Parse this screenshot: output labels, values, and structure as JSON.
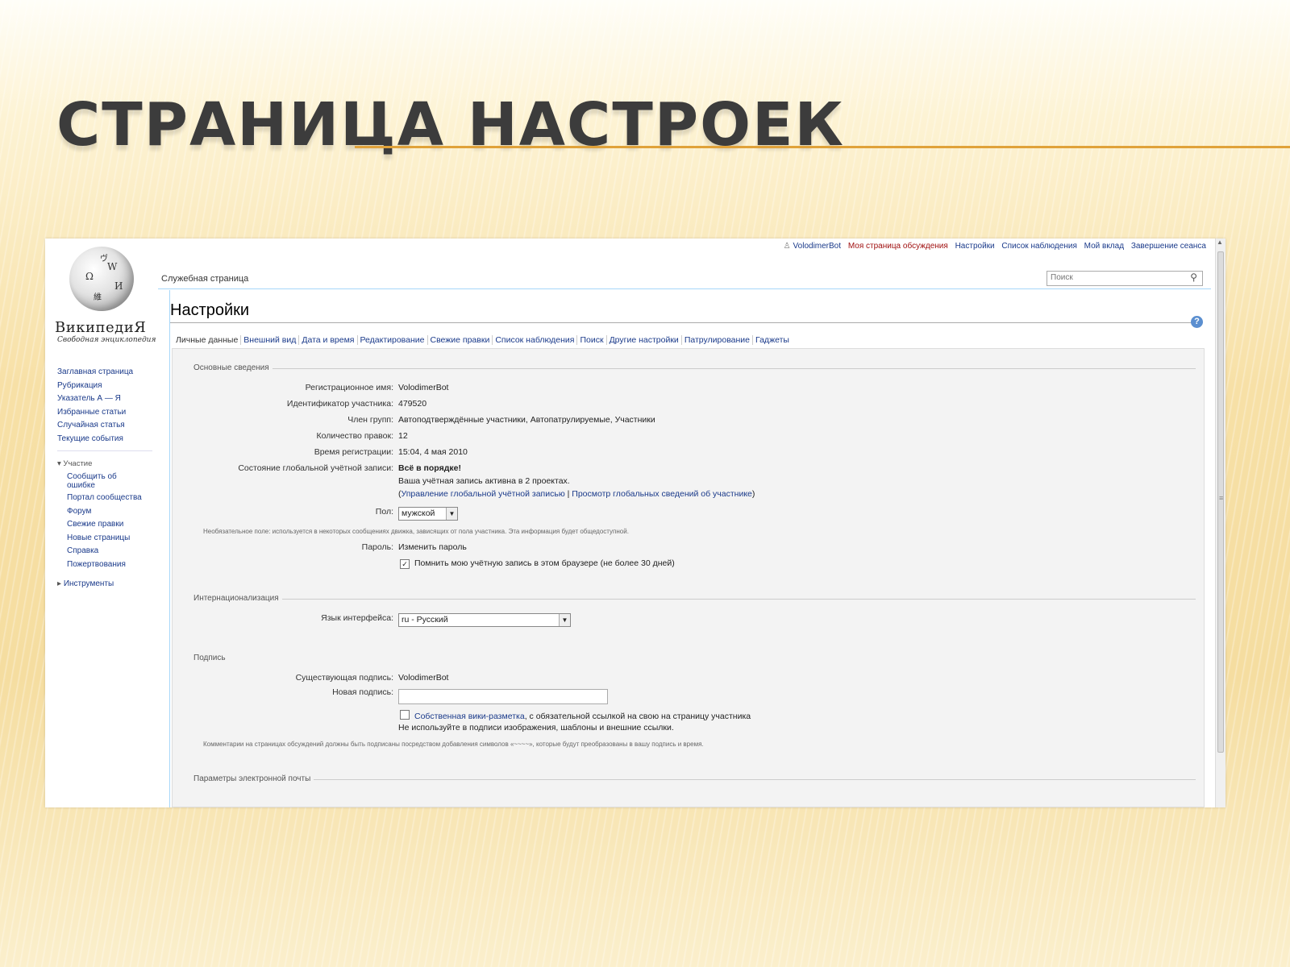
{
  "slide": {
    "title": "Страница настроек"
  },
  "wiki": {
    "logo": {
      "name": "ВикипедиЯ",
      "tagline": "Свободная энциклопедия",
      "globe_glyphs": [
        "W",
        "Ω",
        "И",
        "ヴ",
        "維"
      ]
    },
    "nav": {
      "main": [
        "Заглавная страница",
        "Рубрикация",
        "Указатель А — Я",
        "Избранные статьи",
        "Случайная статья",
        "Текущие события"
      ],
      "participation_heading": "Участие",
      "participation": [
        "Сообщить об ошибке",
        "Портал сообщества",
        "Форум",
        "Свежие правки",
        "Новые страницы",
        "Справка",
        "Пожертвования"
      ],
      "tools": "Инструменты"
    },
    "personal_bar": {
      "user": "VolodimerBot",
      "talk": "Моя страница обсуждения",
      "preferences": "Настройки",
      "watchlist": "Список наблюдения",
      "contributions": "Мой вклад",
      "logout": "Завершение сеанса"
    },
    "special_tab": "Служебная страница",
    "search": {
      "placeholder": "Поиск"
    },
    "page_title": "Настройки",
    "tabs": [
      "Личные данные",
      "Внешний вид",
      "Дата и время",
      "Редактирование",
      "Свежие правки",
      "Список наблюдения",
      "Поиск",
      "Другие настройки",
      "Патрулирование",
      "Гаджеты"
    ],
    "basic": {
      "legend": "Основные сведения",
      "username_label": "Регистрационное имя:",
      "username": "VolodimerBot",
      "id_label": "Идентификатор участника:",
      "id": "479520",
      "groups_label": "Член групп:",
      "groups": "Автоподтверждённые участники, Автопатрулируемые, Участники",
      "edits_label": "Количество правок:",
      "edits": "12",
      "regtime_label": "Время регистрации:",
      "regtime": "15:04, 4 мая 2010",
      "global_label": "Состояние глобальной учётной записи:",
      "global_status": "Всё в порядке!",
      "global_active": "Ваша учётная запись активна в 2 проектах.",
      "global_manage": "Управление глобальной учётной записью",
      "global_sep": "|",
      "global_view": "Просмотр глобальных сведений об участнике",
      "gender_label": "Пол:",
      "gender_value": "мужской",
      "gender_note": "Необязательное поле: используется в некоторых сообщениях движка, зависящих от пола участника. Эта информация будет общедоступной.",
      "password_label": "Пароль:",
      "password_link": "Изменить пароль",
      "remember": "Помнить мою учётную запись в этом браузере (не более 30 дней)"
    },
    "i18n": {
      "legend": "Интернационализация",
      "language_label": "Язык интерфейса:",
      "language_value": "ru - Русский"
    },
    "signature": {
      "legend": "Подпись",
      "existing_label": "Существующая подпись:",
      "existing_value": "VolodimerBot",
      "new_label": "Новая подпись:",
      "new_value": "",
      "raw_link": "Собственная вики-разметка",
      "raw_text": ", с обязательной ссылкой на свою на страницу участника",
      "raw_note": "Не используйте в подписи изображения, шаблоны и внешние ссылки.",
      "comment_note": "Комментарии на страницах обсуждений должны быть подписаны посредством добавления символов «~~~~», которые будут преобразованы в вашу подпись и время."
    },
    "email": {
      "legend": "Параметры электронной почты"
    }
  }
}
